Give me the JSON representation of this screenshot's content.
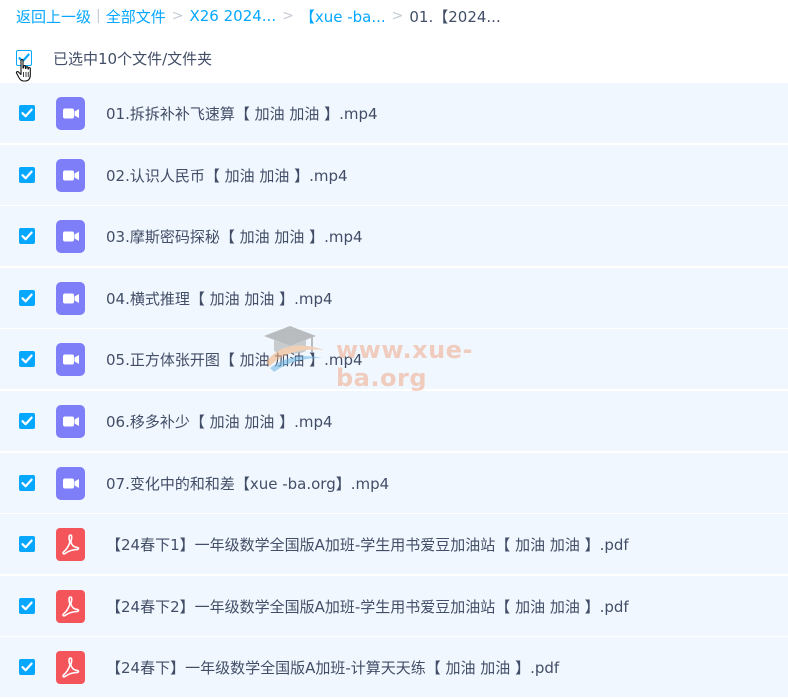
{
  "breadcrumb": {
    "back": "返回上一级",
    "all_files": "全部文件",
    "level1": "X26 2024...",
    "level2": "【xue -ba...",
    "current": "01.【2024..."
  },
  "selection": {
    "label": "已选中10个文件/文件夹"
  },
  "files": [
    {
      "name": "01.拆拆补补飞速算【 加油 加油 】.mp4",
      "type": "video-icon"
    },
    {
      "name": "02.认识人民币【 加油 加油 】.mp4",
      "type": "video-icon"
    },
    {
      "name": "03.摩斯密码探秘【 加油 加油 】.mp4",
      "type": "video-icon"
    },
    {
      "name": "04.横式推理【 加油 加油 】.mp4",
      "type": "video-icon"
    },
    {
      "name": "05.正方体张开图【 加油 加油 】.mp4",
      "type": "video-icon"
    },
    {
      "name": "06.移多补少【 加油 加油 】.mp4",
      "type": "video-icon"
    },
    {
      "name": "07.变化中的和和差【xue -ba.org】.mp4",
      "type": "video-icon"
    },
    {
      "name": "【24春下1】一年级数学全国版A加班-学生用书爱豆加油站【 加油 加油 】.pdf",
      "type": "pdf-icon"
    },
    {
      "name": "【24春下2】一年级数学全国版A加班-学生用书爱豆加油站【 加油 加油 】.pdf",
      "type": "pdf-icon"
    },
    {
      "name": "【24春下】一年级数学全国版A加班-计算天天练【 加油 加油 】.pdf",
      "type": "pdf-icon"
    }
  ],
  "watermark": {
    "text": "www.xue-ba.org"
  },
  "colors": {
    "accent": "#06a7ff",
    "row_bg": "#f0f7fe",
    "video_icon": "#7e7ef8",
    "pdf_icon": "#f4555a",
    "text": "#424e67"
  }
}
